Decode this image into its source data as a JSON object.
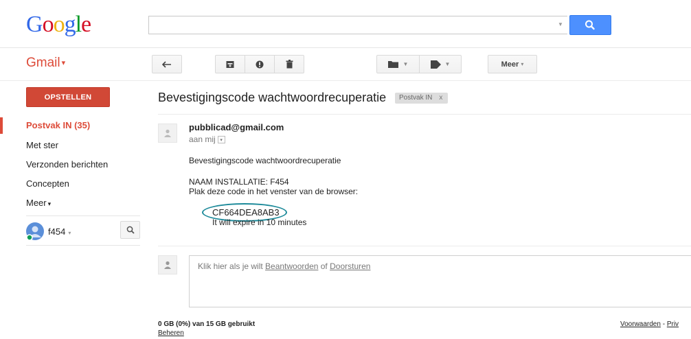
{
  "header": {
    "logo_letters": [
      "G",
      "o",
      "o",
      "g",
      "l",
      "e"
    ],
    "search": {
      "value": "",
      "placeholder": ""
    }
  },
  "app": {
    "name": "Gmail",
    "caret": "▾"
  },
  "toolbar": {
    "reply_icon": "reply-icon",
    "archive_icon": "archive-icon",
    "spam_icon": "report-spam-icon",
    "delete_icon": "trash-icon",
    "move_icon": "folder-icon",
    "labels_icon": "label-tag-icon",
    "more_label": "Meer",
    "more_caret": "▾"
  },
  "sidebar": {
    "compose_label": "OPSTELLEN",
    "items": [
      {
        "label": "Postvak IN (35)",
        "active": true
      },
      {
        "label": "Met ster"
      },
      {
        "label": "Verzonden berichten"
      },
      {
        "label": "Concepten"
      },
      {
        "label": "Meer"
      }
    ],
    "more_caret": "▾",
    "user": {
      "name": "f454",
      "caret": "▾",
      "status_color": "#0f9d58"
    }
  },
  "message": {
    "subject": "Bevestigingscode wachtwoordrecuperatie",
    "label_chip": "Postvak IN",
    "label_remove": "x",
    "sender": "pubblicad@gmail.com",
    "recipient": "aan mij",
    "recipient_caret": "▾",
    "body": [
      "Bevestigingscode wachtwoordrecuperatie",
      "NAAM INSTALLATIE: F454",
      "Plak deze code in het venster van de browser:"
    ],
    "code": "CF664DEA8AB3",
    "expire": "It will expire in 10 minutes",
    "highlight_color": "#1d8a9a"
  },
  "reply": {
    "prefix": "Klik hier als je wilt ",
    "reply_link": "Beantwoorden",
    "middle": " of ",
    "forward_link": "Doorsturen"
  },
  "footer": {
    "quota": "0 GB (0%) van 15 GB gebruikt",
    "manage": "Beheren",
    "terms": "Voorwaarden",
    "separator": " - ",
    "privacy": "Priv"
  },
  "colors": {
    "accent_red": "#dd4b39",
    "compose_red": "#d14836",
    "search_blue": "#4d90fe"
  }
}
